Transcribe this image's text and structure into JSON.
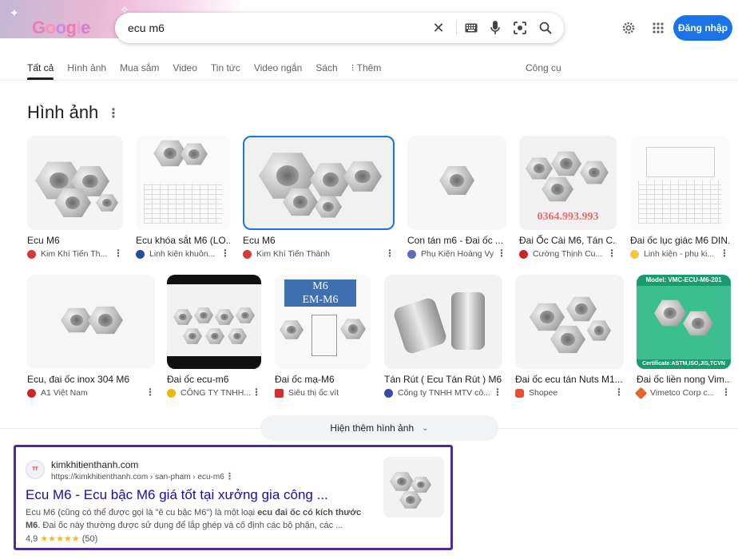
{
  "search": {
    "query": "ecu m6"
  },
  "header": {
    "signin_label": "Đăng nhập"
  },
  "tabs": [
    {
      "label": "Tất cả"
    },
    {
      "label": "Hình ảnh"
    },
    {
      "label": "Mua sắm"
    },
    {
      "label": "Video"
    },
    {
      "label": "Tin tức"
    },
    {
      "label": "Video ngắn"
    },
    {
      "label": "Sách"
    },
    {
      "label": "⁝ Thêm"
    }
  ],
  "tools_label": "Công cụ",
  "images_section": {
    "title": "Hình ảnh",
    "row1": [
      {
        "title": "Ecu M6",
        "source": "Kim Khí Tiến Th...",
        "fav_color": "#d43b3b"
      },
      {
        "title": "Ecu khóa sắt M6 (LO...",
        "source": "Linh kiện khuôn...",
        "fav_color": "#2e4a9e"
      },
      {
        "title": "Ecu M6",
        "source": "Kim Khí Tiến Thành",
        "fav_color": "#d43b3b"
      },
      {
        "title": "Con tán m6 - Đai ốc ...",
        "source": "Phụ Kiện Hoàng Vy",
        "fav_color": "#5c6bc0"
      },
      {
        "title": "Đai Ốc Cài M6, Tán C...",
        "source": "Cường Thịnh Cu...",
        "fav_color": "#c62828"
      },
      {
        "title": "Đai ốc lục giác M6 DIN...",
        "source": "Linh kiện - phụ ki...",
        "fav_color": "#f5c542"
      }
    ],
    "row2": [
      {
        "title": "Ecu, đai ốc inox 304 M6",
        "source": "A1 Việt Nam",
        "fav_color": "#c62828"
      },
      {
        "title": "Đai ốc ecu-m6",
        "source": "CÔNG TY TNHH...",
        "fav_color": "#f1b800"
      },
      {
        "title": "Đai ốc mạ-M6",
        "source": "Siêu thị ốc vít",
        "fav_color": "#d32f2f"
      },
      {
        "title": "Tán Rút ( Ecu Tán Rút ) M6 ...",
        "source": "Công ty TNHH MTV cô...",
        "fav_color": "#3949ab"
      },
      {
        "title": "Đai ốc ecu tán Nuts M1....",
        "source": "Shopee",
        "fav_color": "#ee4d2d"
      },
      {
        "title": "Đai ốc liền nong Vim...",
        "source": "Vimetco Corp c...",
        "fav_color": "#e0662a"
      }
    ],
    "overlay_texts": {
      "phone": "0364.993.993",
      "m6": "M6",
      "em_m6": "EM-M6",
      "vmc_model": "Model: VMC-ECU-M6-201",
      "vmc_cert": "Certificate:ASTM,ISO,JIS,TCVN"
    },
    "show_more_label": "Hiện thêm hình ảnh"
  },
  "result": {
    "site_name": "kimkhitienthanh.com",
    "url": "https://kimkhitienthanh.com › san-pham › ecu-m6",
    "title": "Ecu M6 - Ecu bậc M6 giá tốt tại xưởng gia công ...",
    "snippet_part1": "Ecu M6 (cũng có thể được gọi là \"ê cu bậc M6\") là một loại ",
    "snippet_bold1": "ecu đai ốc có kích thước M6",
    "snippet_part2": ". Đai ốc này thường được sử dụng để lắp ghép và cố định các bộ phận, các ...",
    "rating_value": "4,9",
    "rating_stars": "★★★★★",
    "rating_count": "(50)"
  },
  "icons": [
    "clear-icon",
    "keyboard-icon",
    "mic-icon",
    "lens-icon",
    "search-icon",
    "settings-icon",
    "apps-icon",
    "chevron-down-icon",
    "more-vert-icon"
  ]
}
